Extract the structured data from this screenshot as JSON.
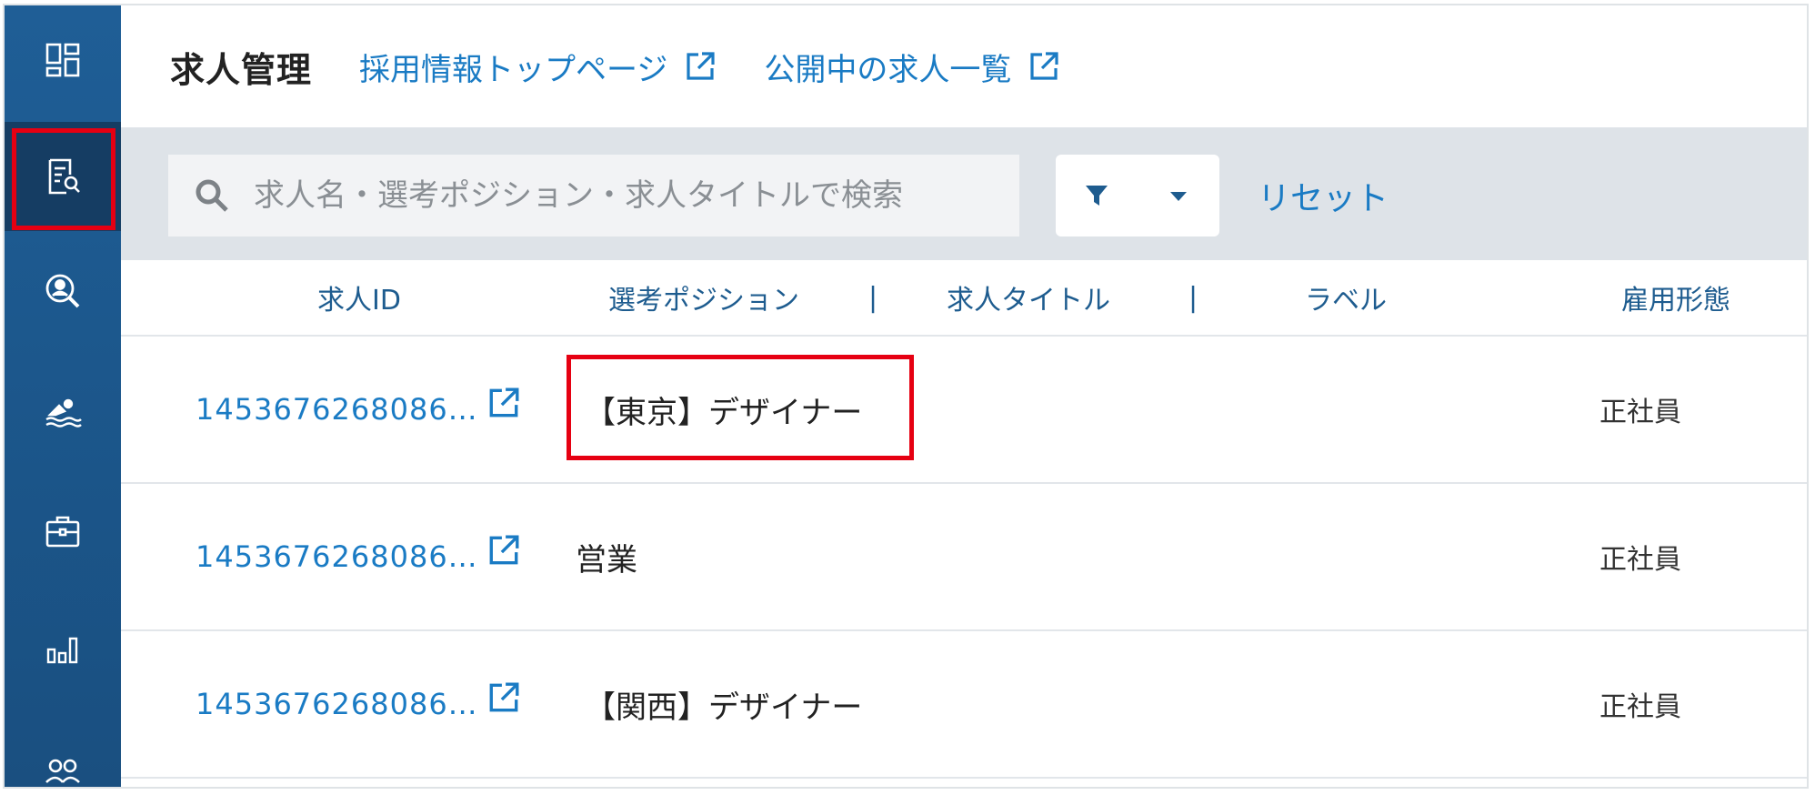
{
  "header": {
    "title": "求人管理",
    "links": [
      {
        "label": "採用情報トップページ",
        "icon": "external-link-icon"
      },
      {
        "label": "公開中の求人一覧",
        "icon": "external-link-icon"
      }
    ]
  },
  "sidebar": {
    "items": [
      {
        "icon": "dashboard-icon",
        "active": false
      },
      {
        "icon": "job-search-document-icon",
        "active": true
      },
      {
        "icon": "candidate-search-icon",
        "active": false
      },
      {
        "icon": "swimmer-icon",
        "active": false
      },
      {
        "icon": "briefcase-icon",
        "active": false
      },
      {
        "icon": "bar-chart-icon",
        "active": false
      },
      {
        "icon": "users-icon",
        "active": false
      }
    ]
  },
  "toolbar": {
    "search_placeholder": "求人名・選考ポジション・求人タイトルで検索",
    "reset_label": "リセット"
  },
  "table": {
    "columns": {
      "id": "求人ID",
      "position": "選考ポジション",
      "separator": "|",
      "title": "求人タイトル",
      "label": "ラベル",
      "employment": "雇用形態"
    },
    "rows": [
      {
        "id": "1453676268086…",
        "position": "【東京】デザイナー",
        "employment": "正社員"
      },
      {
        "id": "1453676268086…",
        "position": "営業",
        "employment": "正社員"
      },
      {
        "id": "1453676268086…",
        "position": "【関西】デザイナー",
        "employment": "正社員"
      }
    ]
  },
  "colors": {
    "sidebar": "#1f5e96",
    "accent": "#1a7bc4",
    "highlight": "#e60012",
    "toolbar_bg": "#dee3e8"
  }
}
